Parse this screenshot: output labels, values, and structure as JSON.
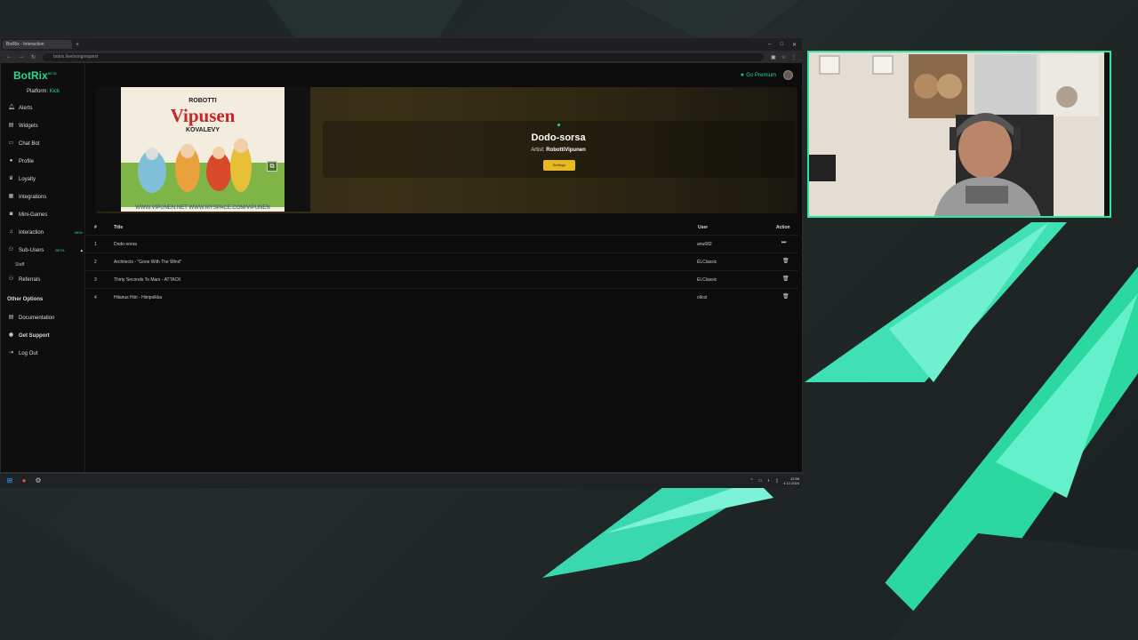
{
  "browser": {
    "tab_title": "BotRix - Interaction",
    "new_tab": "+",
    "url": "botrix.live/songrequest",
    "window_controls": [
      "–",
      "□",
      "✕"
    ]
  },
  "app": {
    "logo": "BotRix",
    "logo_badge": "BETA",
    "platform_label": "Platform:",
    "platform_value": "Kick",
    "go_premium": "★ Go Premium",
    "nav": [
      {
        "label": "Alerts",
        "icon": "bell-icon"
      },
      {
        "label": "Widgets",
        "icon": "widgets-icon"
      },
      {
        "label": "Chat Bot",
        "icon": "chat-icon"
      },
      {
        "label": "Profile",
        "icon": "user-icon"
      },
      {
        "label": "Loyalty",
        "icon": "trophy-icon"
      },
      {
        "label": "Integrations",
        "icon": "grid-icon"
      },
      {
        "label": "Mini-Games",
        "icon": "gamepad-icon"
      },
      {
        "label": "Interaction",
        "icon": "music-icon",
        "badge": "NEW"
      },
      {
        "label": "Sub-Users",
        "icon": "sub-users-icon",
        "badge": "BETA"
      }
    ],
    "nav_sub_item": "Staff",
    "nav_referrals": "Referrals",
    "other_options_heading": "Other Options",
    "other_nav": [
      {
        "label": "Documentation"
      },
      {
        "label": "Get Support"
      },
      {
        "label": "Log Out"
      }
    ]
  },
  "now_playing": {
    "song_title": "Dodo-sorsa",
    "artist_label": "Artist:",
    "artist": "RobottiVipunen",
    "settings_button": "Settings",
    "cover": {
      "top": "ROBOTTI",
      "title": "Vipusen",
      "subtitle": "KOVALEVY",
      "url": "WWW.VIPUNEN.NET WWW.MYSPACE.COM/VIPUNEN"
    }
  },
  "queue": {
    "headers": {
      "num": "#",
      "title": "Title",
      "user": "User",
      "action": "Action"
    },
    "rows": [
      {
        "num": "1",
        "title": "Dodo-sorsa",
        "user": "anu682",
        "action": "skip-icon"
      },
      {
        "num": "2",
        "title": "Architects - \"Gone With The Wind\"",
        "user": "ELClassic",
        "action": "trash-icon"
      },
      {
        "num": "3",
        "title": "Thirty Seconds To Mars - ATTACK",
        "user": "ELClassic",
        "action": "trash-icon"
      },
      {
        "num": "4",
        "title": "Hilarius Hiiri - Hiiripolkka",
        "user": "ollcol",
        "action": "trash-icon"
      }
    ]
  },
  "taskbar": {
    "clock_time": "12:58",
    "clock_date": "4.12.2024"
  },
  "colors": {
    "accent": "#29d98f",
    "webcam_border": "#2ee6a0",
    "settings_button": "#e8b923"
  }
}
